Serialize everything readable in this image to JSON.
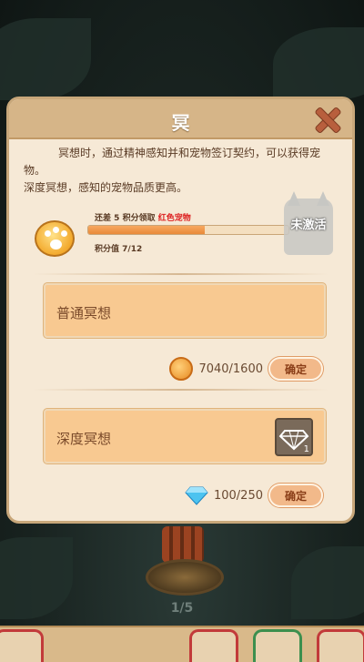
{
  "modal": {
    "title": "冥",
    "desc_line1": "冥想时，通过精神感知并和宠物签订契约，可以获得宠物。",
    "desc_line2": "深度冥想，感知的宠物品质更高。"
  },
  "progress": {
    "remaining_prefix": "还差",
    "remaining_count": "5",
    "remaining_suffix": "积分领取",
    "reward_name": "红色宠物",
    "points_label": "积分值",
    "points_value": "7/12",
    "fill_fraction": 0.58,
    "locked_label": "未激活"
  },
  "options": [
    {
      "label": "普通冥想",
      "cost": "7040/1600",
      "cost_icon": "pet-food-icon",
      "confirm": "确定"
    },
    {
      "label": "深度冥想",
      "cost": "100/250",
      "cost_icon": "diamond-icon",
      "item_count": "1",
      "confirm": "确定"
    }
  ],
  "background": {
    "counter": "1/5"
  },
  "colors": {
    "header": "#d6b588",
    "panel": "#f6e9d6",
    "option_box": "#f8c991",
    "confirm_btn": "#f2b98a",
    "reward_red": "#dd2222",
    "progress_fill": "#e98a3a"
  }
}
